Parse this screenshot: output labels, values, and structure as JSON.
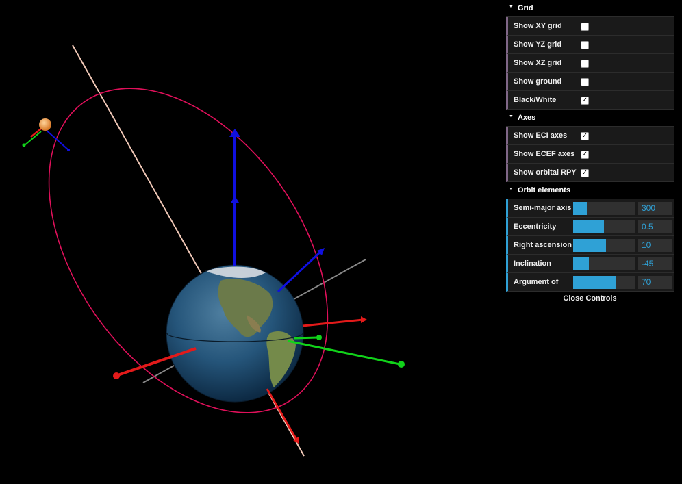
{
  "colors": {
    "orbit": "#e0105a",
    "x_axis": "#e31a1a",
    "y_axis": "#11d31a",
    "z_axis": "#1010e0",
    "sun_line": "#f2c9b8",
    "accent": "#2fa1d6"
  },
  "gui": {
    "folders": [
      {
        "title": "Grid",
        "controls": [
          {
            "label": "Show XY grid",
            "checked": false
          },
          {
            "label": "Show YZ grid",
            "checked": false
          },
          {
            "label": "Show XZ grid",
            "checked": false
          },
          {
            "label": "Show ground",
            "checked": false
          },
          {
            "label": "Black/White",
            "checked": true
          }
        ]
      },
      {
        "title": "Axes",
        "controls": [
          {
            "label": "Show ECI axes",
            "checked": true
          },
          {
            "label": "Show ECEF axes",
            "checked": true
          },
          {
            "label": "Show orbital RPY",
            "checked": true
          }
        ]
      },
      {
        "title": "Orbit elements",
        "controls": [
          {
            "label": "Semi-major axis",
            "value": "300",
            "fill": 0.22
          },
          {
            "label": "Eccentricity",
            "value": "0.5",
            "fill": 0.5
          },
          {
            "label": "Right ascension o",
            "value": "10",
            "fill": 0.53
          },
          {
            "label": "Inclination",
            "value": "-45",
            "fill": 0.25
          },
          {
            "label": "Argument of",
            "value": "70",
            "fill": 0.7
          }
        ]
      }
    ],
    "close_label": "Close Controls"
  }
}
